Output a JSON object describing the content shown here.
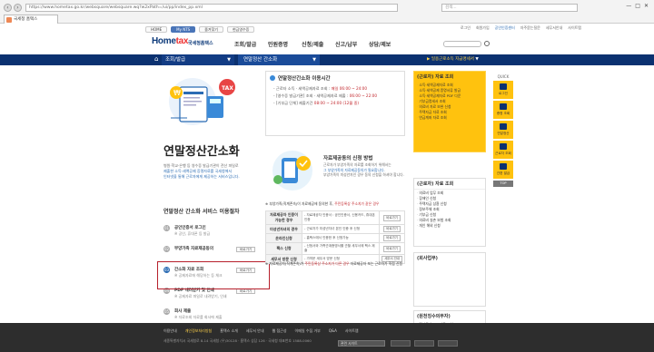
{
  "browser": {
    "url": "https://www.hometax.go.kr/websquare/websquare.wq?w2xPath=/ui/pp/index_pp.xml",
    "tab_title": "국세청 홈택스",
    "search_placeholder": "검색...",
    "window_controls": [
      "—",
      "□",
      "✕"
    ]
  },
  "header": {
    "top_links": [
      {
        "label": "로그인",
        "hl": false
      },
      {
        "label": "회원가입",
        "hl": false
      },
      {
        "label": "공인인증센터",
        "hl": true
      },
      {
        "label": "자주묻는질문",
        "hl": false
      },
      {
        "label": "세무서안내",
        "hl": false
      },
      {
        "label": "사이트맵",
        "hl": false
      }
    ],
    "lnb_tabs": [
      {
        "label": "HOME",
        "on": false
      },
      {
        "label": "My NTS",
        "on": true
      },
      {
        "label": "즐겨찾기",
        "on": false
      },
      {
        "label": "현금영수증",
        "on": false
      }
    ],
    "logo_home": "Home",
    "logo_tax": "tax",
    "logo_sub": "국세청홈택스",
    "gnb": [
      "조회/발급",
      "민원증명",
      "신청/제출",
      "신고/납부",
      "상담/제보"
    ]
  },
  "bluebar": {
    "crumb1": "조회/발급",
    "crumb2": "연말정산 간소화",
    "right_text": "▶ 일용근로소득 지급명세서",
    "right_btn": "▼"
  },
  "left": {
    "hero_title": "연말정산간소화",
    "hero_desc_1": "병원·학교·은행 등 영수증 발급기관이 전산 파일로",
    "hero_desc_2": "제출한 소득·세액공제 증명자료를 국세청에서",
    "hero_desc_3": "인터넷을 통해 근로자에게 제공하는 서비스입니다.",
    "process_title": "연말정산 간소화 서비스 이용절차",
    "steps": [
      {
        "num": "01",
        "title": "공인인증서 로그인",
        "desc": "※ 공인, 휴대폰 등 발급",
        "btn": ""
      },
      {
        "num": "02",
        "title": "부양가족 자료제공동의",
        "desc": "",
        "btn": "바로가기"
      },
      {
        "num": "03",
        "title": "간소화 자료 조회",
        "desc": "※ 공제자료에 해당하는 등 체크",
        "btn": "바로가기"
      },
      {
        "num": "04",
        "title": "PDF 내려받기 및 인쇄",
        "desc": "※ 공제자료 파일로 내려받기, 인쇄",
        "btn": "바로가기"
      },
      {
        "num": "05",
        "title": "회사 제출",
        "desc": "※ 자료조회 자료를 회사에 제출",
        "btn": ""
      }
    ]
  },
  "center": {
    "hours_title": "연말정산간소화 이용시간",
    "hours_lines": [
      {
        "label": "- 근로자 소득 · 세액공제자료 조회 :",
        "value": "매일 06:00 ~ 24:00"
      },
      {
        "label": "- [영수증 발급기관] 조회 · 세액공제자료 제출 :",
        "value": "06:00 ~ 22:00"
      },
      {
        "label": "- [기부금 단체] 제출기간",
        "value": "08:00 ~ 24:00 (12월 중)"
      }
    ],
    "apply_title": "자료제공동의 신청 방법",
    "apply_desc_1": "근로자가 부양가족의 자료를 조회하기 위해서는",
    "apply_desc_2": "그 부양가족의 자료제공동의가 필요합니다.",
    "apply_desc_3": "부양가족이 미성년자인 경우 동의 신청을 하셔야 합니다.",
    "notice1_pre": "※ 부양가족(직계존속)이 자료제공에 동의한 후,",
    "notice1_hl": "주민등록상 주소지가 같은 경우",
    "table": [
      {
        "th": "자료제공자 인증이 가능한 경우",
        "body": "- 자료제공자 인증서 : 공인인증서, 신용카드, 휴대폰 인증",
        "btn": "바로가기"
      },
      {
        "th": "미성년자녀의 경우",
        "body": "- 근로자가 미성년자녀 본인 인증 후 신청",
        "btn": "바로가기"
      },
      {
        "th": "온라인신청",
        "body": "- 홈택스에서 인증한 후 신청가능",
        "btn": "바로가기"
      },
      {
        "th": "팩스 신청",
        "body": "- 신청서와 가족관계증명서를 관할 세무서에 팩스 제출",
        "btn": "바로가기"
      },
      {
        "th": "세무서 방문 신청",
        "body": "- 가까운 세무서 방문 신청",
        "btn": "세무서 안내"
      }
    ],
    "notice2_pre": "※ 자료제공자(직계존속)가",
    "notice2_hl": "주민등록상 주소지가 다른 경우",
    "notice2_post": "자료제공자 또는 근로자가 직접 신청"
  },
  "right": {
    "box1_title": "(근로자) 자료 조회",
    "box1_items": [
      "소득·세액공제자료 조회",
      "소득·세액공제 증명서류 발급",
      "소득·세액공제자료 PDF 다운",
      "기부금명세서 조회",
      "의료비 자료 보완 신청",
      "주택자금 자료 조회",
      "연금계좌 자료 조회"
    ],
    "box2_title": "(근로자) 자료 조회",
    "box2_items": [
      "의료비 업무 조회",
      "장애인 신청",
      "주택자금 상환 신청",
      "정보주체 조회",
      "기부금 신청",
      "의료비 실손 보험 조회",
      "개인 해외 신청"
    ],
    "box3_title": "(회사업무)",
    "box3_items": [],
    "box4_title": "(원천징수의무자)",
    "box4_items": [
      "전자문서 API 자료 조회"
    ]
  },
  "quick": {
    "title": "QUICK",
    "items": [
      "로그인",
      "증명 조회",
      "연말정산",
      "근로자 조회",
      "간편 발급"
    ],
    "top": "TOP"
  },
  "footer": {
    "links": [
      {
        "label": "이용안내",
        "hl": false
      },
      {
        "label": "개인정보처리방침",
        "hl": true
      },
      {
        "label": "홈택스 소개",
        "hl": false
      },
      {
        "label": "세무서 안내",
        "hl": false
      },
      {
        "label": "웹 접근성",
        "hl": false
      },
      {
        "label": "이메일 수집 거부",
        "hl": false
      },
      {
        "label": "Q&A",
        "hl": false
      },
      {
        "label": "사이트맵",
        "hl": false
      }
    ],
    "address": "세종특별자치시 국세청로 8-14 국세청 (우)30128 · 홈택스 상담 126 · 국세청 대표번호 1588-0060",
    "select": "관련 사이트"
  }
}
